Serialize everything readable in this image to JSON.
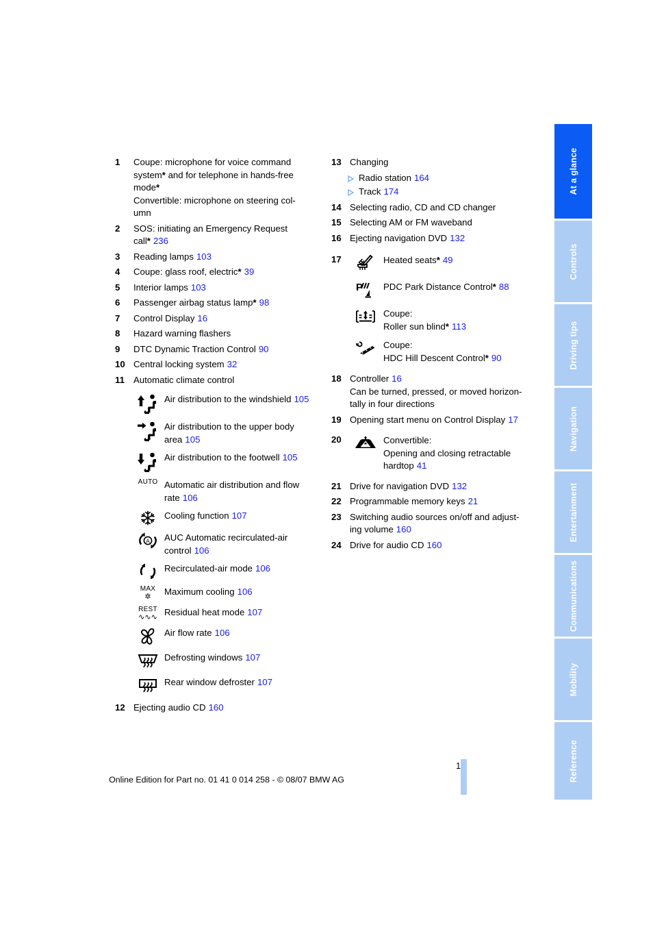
{
  "document": {
    "page_number": "15",
    "footer": "Online Edition for Part no. 01 41 0 014 258 - © 08/07 BMW AG",
    "accent_blue": "#1a1aee",
    "tab_active_color": "#0a5cf5",
    "tab_inactive_color": "#aecdf5"
  },
  "tabs": [
    {
      "label": "At a glance",
      "active": true
    },
    {
      "label": "Controls",
      "active": false
    },
    {
      "label": "Driving tips",
      "active": false
    },
    {
      "label": "Navigation",
      "active": false
    },
    {
      "label": "Entertainment",
      "active": false
    },
    {
      "label": "Communications",
      "active": false
    },
    {
      "label": "Mobility",
      "active": false
    },
    {
      "label": "Reference",
      "active": false
    }
  ],
  "left_column": {
    "item1": {
      "num": "1",
      "line1": "Coupe: microphone for voice command",
      "line2_a": "system",
      "line2_b": " and for telephone in hands-free",
      "line3": "mode",
      "line4": "Convertible: microphone on steering col-",
      "line5": "umn"
    },
    "item2": {
      "num": "2",
      "line1": "SOS: initiating an Emergency Request",
      "line2": "call",
      "page": "236"
    },
    "item3": {
      "num": "3",
      "text": "Reading lamps",
      "page": "103"
    },
    "item4": {
      "num": "4",
      "text": "Coupe: glass roof, electric",
      "page": "39"
    },
    "item5": {
      "num": "5",
      "text": "Interior lamps",
      "page": "103"
    },
    "item6": {
      "num": "6",
      "text": "Passenger airbag status lamp",
      "page": "98"
    },
    "item7": {
      "num": "7",
      "text": "Control Display",
      "page": "16"
    },
    "item8": {
      "num": "8",
      "text": "Hazard warning flashers",
      "page": ""
    },
    "item9": {
      "num": "9",
      "text": "DTC Dynamic Traction Control",
      "page": "90"
    },
    "item10": {
      "num": "10",
      "text": "Central locking system",
      "page": "32"
    },
    "item11": {
      "num": "11",
      "text": "Automatic climate control"
    },
    "climate_icons": [
      {
        "icon": "air-distribution-windshield-icon",
        "text": "Air distribution to the windshield",
        "page": "105"
      },
      {
        "icon": "air-distribution-upper-body-icon",
        "text": "Air distribution to the upper body area",
        "page": "105"
      },
      {
        "icon": "air-distribution-footwell-icon",
        "text": "Air distribution to the footwell",
        "page": "105"
      },
      {
        "icon": "auto-climate-icon",
        "icon_text": "AUTO",
        "text": "Automatic air distribution and flow rate",
        "page": "106"
      },
      {
        "icon": "snowflake-cooling-icon",
        "text": "Cooling function",
        "page": "107"
      },
      {
        "icon": "auc-recirculated-air-icon",
        "text": "AUC Automatic recirculated-air control",
        "page": "106"
      },
      {
        "icon": "recirculated-air-icon",
        "text": "Recirculated-air mode",
        "page": "106"
      },
      {
        "icon": "maximum-cooling-icon",
        "icon_text": "MAX",
        "text": "Maximum cooling",
        "page": "106"
      },
      {
        "icon": "residual-heat-icon",
        "icon_text": "REST",
        "text": "Residual heat mode",
        "page": "107"
      },
      {
        "icon": "air-flow-rate-fan-icon",
        "text": "Air flow rate",
        "page": "106"
      },
      {
        "icon": "defrosting-windows-icon",
        "text": "Defrosting windows",
        "page": "107"
      },
      {
        "icon": "rear-window-defroster-icon",
        "text": "Rear window defroster",
        "page": "107"
      }
    ],
    "item12": {
      "num": "12",
      "text": "Ejecting audio CD",
      "page": "160"
    }
  },
  "right_column": {
    "item13": {
      "num": "13",
      "text": "Changing",
      "sub": [
        {
          "text": "Radio station",
          "page": "164"
        },
        {
          "text": "Track",
          "page": "174"
        }
      ]
    },
    "item14": {
      "num": "14",
      "text": "Selecting radio, CD and CD changer",
      "page": ""
    },
    "item15": {
      "num": "15",
      "text": "Selecting AM or FM waveband",
      "page": ""
    },
    "item16": {
      "num": "16",
      "text": "Ejecting navigation DVD",
      "page": "132"
    },
    "item17": {
      "num": "17",
      "icons": [
        {
          "icon": "heated-seats-icon",
          "text": "Heated seats",
          "asterisk": true,
          "page": "49"
        },
        {
          "icon": "pdc-park-distance-control-icon",
          "text": "PDC Park Distance Control",
          "asterisk": true,
          "page": "88"
        },
        {
          "icon": "roller-sun-blind-icon",
          "line1": "Coupe:",
          "line2": "Roller sun blind",
          "asterisk": true,
          "page": "113"
        },
        {
          "icon": "hdc-hill-descent-control-icon",
          "line1": "Coupe:",
          "line2": "HDC Hill Descent Control",
          "asterisk": true,
          "page": "90"
        }
      ]
    },
    "item18": {
      "num": "18",
      "line1": "Controller",
      "page": "16",
      "line2": "Can be turned, pressed, or moved horizon-",
      "line3": "tally in four directions"
    },
    "item19": {
      "num": "19",
      "text": "Opening start menu on Control Display",
      "page": "17"
    },
    "item20": {
      "num": "20",
      "icon": "retractable-hardtop-icon",
      "line1": "Convertible:",
      "line2": "Opening and closing retractable",
      "line3": "hardtop",
      "page": "41"
    },
    "item21": {
      "num": "21",
      "text": "Drive for navigation DVD",
      "page": "132"
    },
    "item22": {
      "num": "22",
      "text": "Programmable memory keys",
      "page": "21"
    },
    "item23": {
      "num": "23",
      "line1": "Switching audio sources on/off and adjust-",
      "line2": "ing volume",
      "page": "160"
    },
    "item24": {
      "num": "24",
      "text": "Drive for audio CD",
      "page": "160"
    }
  }
}
